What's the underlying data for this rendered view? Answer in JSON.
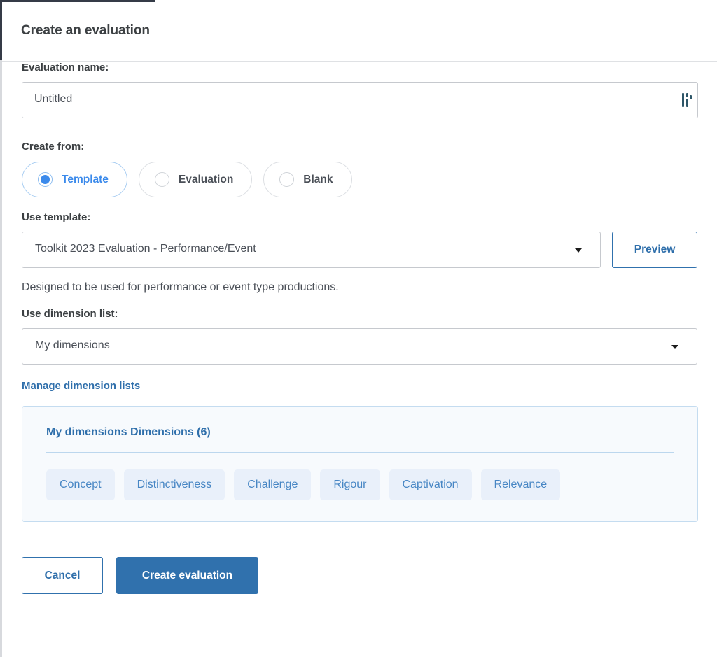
{
  "dialog": {
    "title": "Create an evaluation"
  },
  "evaluation_name": {
    "label": "Evaluation name:",
    "value": "Untitled",
    "placeholder": "Untitled",
    "grip_icon": "resize-grip-icon"
  },
  "create_from": {
    "label": "Create from:",
    "options": [
      {
        "label": "Template",
        "selected": true
      },
      {
        "label": "Evaluation",
        "selected": false
      },
      {
        "label": "Blank",
        "selected": false
      }
    ]
  },
  "use_template": {
    "label": "Use template:",
    "value": "Toolkit 2023 Evaluation - Performance/Event",
    "caret_icon": "chevron-down-icon",
    "preview_label": "Preview",
    "description": "Designed to be used for performance or event type productions."
  },
  "use_dimension_list": {
    "label": "Use dimension list:",
    "value": "My dimensions",
    "caret_icon": "chevron-down-icon",
    "manage_link": "Manage dimension lists"
  },
  "dimensions_panel": {
    "title": "My dimensions Dimensions (6)",
    "count": 6,
    "chips": [
      "Concept",
      "Distinctiveness",
      "Challenge",
      "Rigour",
      "Captivation",
      "Relevance"
    ]
  },
  "footer": {
    "cancel_label": "Cancel",
    "create_label": "Create evaluation"
  },
  "colors": {
    "primary_blue": "#3071ad",
    "link_blue": "#2f6fab",
    "radio_blue": "#3b8aeb",
    "panel_bg": "#f7fafd",
    "panel_border": "#c4dcf0",
    "chip_bg": "#e9f0fa",
    "chip_text": "#4786c4",
    "chrome_dark": "#353b47"
  }
}
